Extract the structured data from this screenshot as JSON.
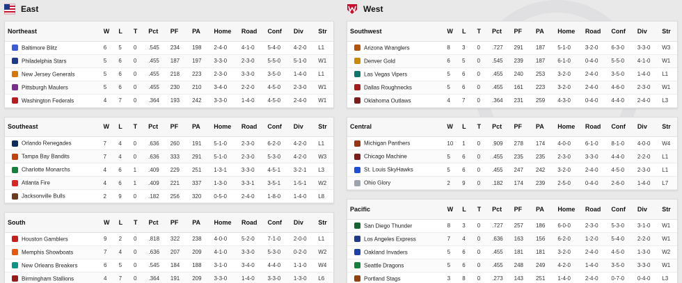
{
  "conferences": [
    {
      "name": "East",
      "logo_icon": "usfl-east-flag-icon",
      "accent": "#c8102e",
      "divisions": [
        {
          "name": "Northeast",
          "teams": [
            {
              "team": "Baltimore Blitz",
              "icon": "#3b5bdb",
              "W": "6",
              "L": "5",
              "T": "0",
              "Pct": ".545",
              "PF": "234",
              "PA": "198",
              "Home": "2-4-0",
              "Road": "4-1-0",
              "Conf": "5-4-0",
              "Div": "4-2-0",
              "Str": "L1"
            },
            {
              "team": "Philadelphia Stars",
              "icon": "#1e3a8a",
              "W": "5",
              "L": "6",
              "T": "0",
              "Pct": ".455",
              "PF": "187",
              "PA": "197",
              "Home": "3-3-0",
              "Road": "2-3-0",
              "Conf": "5-5-0",
              "Div": "5-1-0",
              "Str": "W1"
            },
            {
              "team": "New Jersey Generals",
              "icon": "#d97706",
              "W": "5",
              "L": "6",
              "T": "0",
              "Pct": ".455",
              "PF": "218",
              "PA": "223",
              "Home": "2-3-0",
              "Road": "3-3-0",
              "Conf": "3-5-0",
              "Div": "1-4-0",
              "Str": "L1"
            },
            {
              "team": "Pittsburgh Maulers",
              "icon": "#7c2d92",
              "W": "5",
              "L": "6",
              "T": "0",
              "Pct": ".455",
              "PF": "230",
              "PA": "210",
              "Home": "3-4-0",
              "Road": "2-2-0",
              "Conf": "4-5-0",
              "Div": "2-3-0",
              "Str": "W1"
            },
            {
              "team": "Washington Federals",
              "icon": "#b91c1c",
              "W": "4",
              "L": "7",
              "T": "0",
              "Pct": ".364",
              "PF": "193",
              "PA": "242",
              "Home": "3-3-0",
              "Road": "1-4-0",
              "Conf": "4-5-0",
              "Div": "2-4-0",
              "Str": "W1"
            }
          ]
        },
        {
          "name": "Southeast",
          "teams": [
            {
              "team": "Orlando Renegades",
              "icon": "#0f2c5c",
              "W": "7",
              "L": "4",
              "T": "0",
              "Pct": ".636",
              "PF": "260",
              "PA": "191",
              "Home": "5-1-0",
              "Road": "2-3-0",
              "Conf": "6-2-0",
              "Div": "4-2-0",
              "Str": "L1"
            },
            {
              "team": "Tampa Bay Bandits",
              "icon": "#c2410c",
              "W": "7",
              "L": "4",
              "T": "0",
              "Pct": ".636",
              "PF": "333",
              "PA": "291",
              "Home": "5-1-0",
              "Road": "2-3-0",
              "Conf": "5-3-0",
              "Div": "4-2-0",
              "Str": "W3"
            },
            {
              "team": "Charlotte Monarchs",
              "icon": "#15803d",
              "W": "4",
              "L": "6",
              "T": "1",
              "Pct": ".409",
              "PF": "229",
              "PA": "251",
              "Home": "1-3-1",
              "Road": "3-3-0",
              "Conf": "4-5-1",
              "Div": "3-2-1",
              "Str": "L3"
            },
            {
              "team": "Atlanta Fire",
              "icon": "#dc2626",
              "W": "4",
              "L": "6",
              "T": "1",
              "Pct": ".409",
              "PF": "221",
              "PA": "337",
              "Home": "1-3-0",
              "Road": "3-3-1",
              "Conf": "3-5-1",
              "Div": "1-5-1",
              "Str": "W2"
            },
            {
              "team": "Jacksonville Bulls",
              "icon": "#6b3a1f",
              "W": "2",
              "L": "9",
              "T": "0",
              "Pct": ".182",
              "PF": "256",
              "PA": "320",
              "Home": "0-5-0",
              "Road": "2-4-0",
              "Conf": "1-8-0",
              "Div": "1-4-0",
              "Str": "L8"
            }
          ]
        },
        {
          "name": "South",
          "teams": [
            {
              "team": "Houston Gamblers",
              "icon": "#c81e1e",
              "W": "9",
              "L": "2",
              "T": "0",
              "Pct": ".818",
              "PF": "322",
              "PA": "238",
              "Home": "4-0-0",
              "Road": "5-2-0",
              "Conf": "7-1-0",
              "Div": "2-0-0",
              "Str": "L1"
            },
            {
              "team": "Memphis Showboats",
              "icon": "#ea580c",
              "W": "7",
              "L": "4",
              "T": "0",
              "Pct": ".636",
              "PF": "207",
              "PA": "209",
              "Home": "4-1-0",
              "Road": "3-3-0",
              "Conf": "5-3-0",
              "Div": "0-2-0",
              "Str": "W2"
            },
            {
              "team": "New Orleans Breakers",
              "icon": "#0d9488",
              "W": "6",
              "L": "5",
              "T": "0",
              "Pct": ".545",
              "PF": "184",
              "PA": "188",
              "Home": "3-1-0",
              "Road": "3-4-0",
              "Conf": "4-4-0",
              "Div": "1-1-0",
              "Str": "W4"
            },
            {
              "team": "Birmingham Stallions",
              "icon": "#991b1b",
              "W": "4",
              "L": "7",
              "T": "0",
              "Pct": ".364",
              "PF": "191",
              "PA": "209",
              "Home": "3-3-0",
              "Road": "1-4-0",
              "Conf": "3-3-0",
              "Div": "1-3-0",
              "Str": "L6"
            }
          ]
        }
      ]
    },
    {
      "name": "West",
      "logo_icon": "usfl-west-shield-icon",
      "accent": "#c8102e",
      "divisions": [
        {
          "name": "Southwest",
          "teams": [
            {
              "team": "Arizona Wranglers",
              "icon": "#b45309",
              "W": "8",
              "L": "3",
              "T": "0",
              "Pct": ".727",
              "PF": "291",
              "PA": "187",
              "Home": "5-1-0",
              "Road": "3-2-0",
              "Conf": "6-3-0",
              "Div": "3-3-0",
              "Str": "W3"
            },
            {
              "team": "Denver Gold",
              "icon": "#ca8a04",
              "W": "6",
              "L": "5",
              "T": "0",
              "Pct": ".545",
              "PF": "239",
              "PA": "187",
              "Home": "6-1-0",
              "Road": "0-4-0",
              "Conf": "5-5-0",
              "Div": "4-1-0",
              "Str": "W1"
            },
            {
              "team": "Las Vegas Vipers",
              "icon": "#0f766e",
              "W": "5",
              "L": "6",
              "T": "0",
              "Pct": ".455",
              "PF": "240",
              "PA": "253",
              "Home": "3-2-0",
              "Road": "2-4-0",
              "Conf": "3-5-0",
              "Div": "1-4-0",
              "Str": "L1"
            },
            {
              "team": "Dallas Roughnecks",
              "icon": "#a61b1b",
              "W": "5",
              "L": "6",
              "T": "0",
              "Pct": ".455",
              "PF": "161",
              "PA": "223",
              "Home": "3-2-0",
              "Road": "2-4-0",
              "Conf": "4-6-0",
              "Div": "2-3-0",
              "Str": "W1"
            },
            {
              "team": "Oklahoma Outlaws",
              "icon": "#7f1d1d",
              "W": "4",
              "L": "7",
              "T": "0",
              "Pct": ".364",
              "PF": "231",
              "PA": "259",
              "Home": "4-3-0",
              "Road": "0-4-0",
              "Conf": "4-4-0",
              "Div": "2-4-0",
              "Str": "L3"
            }
          ]
        },
        {
          "name": "Central",
          "teams": [
            {
              "team": "Michigan Panthers",
              "icon": "#9a3412",
              "W": "10",
              "L": "1",
              "T": "0",
              "Pct": ".909",
              "PF": "278",
              "PA": "174",
              "Home": "4-0-0",
              "Road": "6-1-0",
              "Conf": "8-1-0",
              "Div": "4-0-0",
              "Str": "W4"
            },
            {
              "team": "Chicago Machine",
              "icon": "#7f1d1d",
              "W": "5",
              "L": "6",
              "T": "0",
              "Pct": ".455",
              "PF": "235",
              "PA": "235",
              "Home": "2-3-0",
              "Road": "3-3-0",
              "Conf": "4-4-0",
              "Div": "2-2-0",
              "Str": "L1"
            },
            {
              "team": "St. Louis SkyHawks",
              "icon": "#1d4ed8",
              "W": "5",
              "L": "6",
              "T": "0",
              "Pct": ".455",
              "PF": "247",
              "PA": "242",
              "Home": "3-2-0",
              "Road": "2-4-0",
              "Conf": "4-5-0",
              "Div": "2-3-0",
              "Str": "L1"
            },
            {
              "team": "Ohio Glory",
              "icon": "#9ca3af",
              "W": "2",
              "L": "9",
              "T": "0",
              "Pct": ".182",
              "PF": "174",
              "PA": "239",
              "Home": "2-5-0",
              "Road": "0-4-0",
              "Conf": "2-6-0",
              "Div": "1-4-0",
              "Str": "L7"
            }
          ]
        },
        {
          "name": "Pacific",
          "teams": [
            {
              "team": "San Diego Thunder",
              "icon": "#166534",
              "W": "8",
              "L": "3",
              "T": "0",
              "Pct": ".727",
              "PF": "257",
              "PA": "186",
              "Home": "6-0-0",
              "Road": "2-3-0",
              "Conf": "5-3-0",
              "Div": "3-1-0",
              "Str": "W1"
            },
            {
              "team": "Los Angeles Express",
              "icon": "#1e3a8a",
              "W": "7",
              "L": "4",
              "T": "0",
              "Pct": ".636",
              "PF": "163",
              "PA": "156",
              "Home": "6-2-0",
              "Road": "1-2-0",
              "Conf": "5-4-0",
              "Div": "2-2-0",
              "Str": "W1"
            },
            {
              "team": "Oakland Invaders",
              "icon": "#1e40af",
              "W": "5",
              "L": "6",
              "T": "0",
              "Pct": ".455",
              "PF": "181",
              "PA": "181",
              "Home": "3-2-0",
              "Road": "2-4-0",
              "Conf": "4-5-0",
              "Div": "1-3-0",
              "Str": "W2"
            },
            {
              "team": "Seattle Dragons",
              "icon": "#15803d",
              "W": "5",
              "L": "6",
              "T": "0",
              "Pct": ".455",
              "PF": "248",
              "PA": "249",
              "Home": "4-2-0",
              "Road": "1-4-0",
              "Conf": "3-5-0",
              "Div": "3-3-0",
              "Str": "W1"
            },
            {
              "team": "Portland Stags",
              "icon": "#92400e",
              "W": "3",
              "L": "8",
              "T": "0",
              "Pct": ".273",
              "PF": "143",
              "PA": "251",
              "Home": "1-4-0",
              "Road": "2-4-0",
              "Conf": "0-7-0",
              "Div": "0-4-0",
              "Str": "L3"
            }
          ]
        }
      ]
    }
  ],
  "columns": [
    "W",
    "L",
    "T",
    "Pct",
    "PF",
    "PA",
    "Home",
    "Road",
    "Conf",
    "Div",
    "Str"
  ]
}
